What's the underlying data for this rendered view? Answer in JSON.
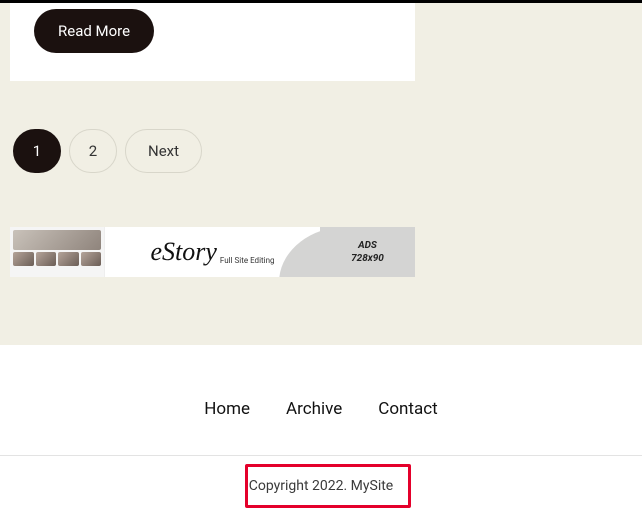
{
  "card": {
    "read_more": "Read More"
  },
  "pagination": {
    "current": "1",
    "page2": "2",
    "next": "Next"
  },
  "ad": {
    "brand": "eStory",
    "tagline": "Full Site Editing",
    "label1": "ADS",
    "label2": "728x90"
  },
  "footer": {
    "nav": {
      "home": "Home",
      "archive": "Archive",
      "contact": "Contact"
    },
    "copyright": "Copyright 2022. MySite"
  }
}
